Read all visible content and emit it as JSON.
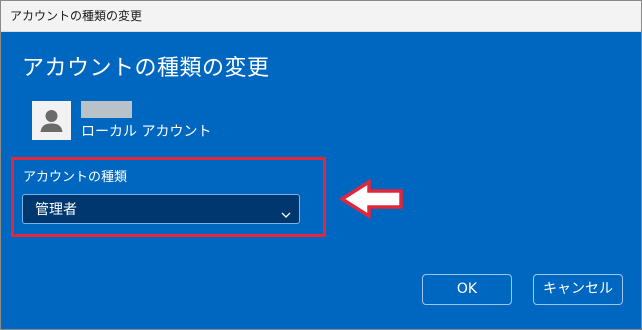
{
  "window": {
    "title": "アカウントの種類の変更"
  },
  "heading": "アカウントの種類の変更",
  "account": {
    "avatar_icon": "user-silhouette-icon",
    "type": "ローカル アカウント"
  },
  "account_type_field": {
    "label": "アカウントの種類",
    "selected": "管理者",
    "dropdown_icon": "chevron-down-icon"
  },
  "annotation": {
    "box_color": "#e4263a",
    "arrow_icon": "left-arrow-icon"
  },
  "buttons": {
    "ok": "OK",
    "cancel": "キャンセル"
  },
  "colors": {
    "dialog_background": "#0067c0",
    "select_background": "#00376e"
  }
}
